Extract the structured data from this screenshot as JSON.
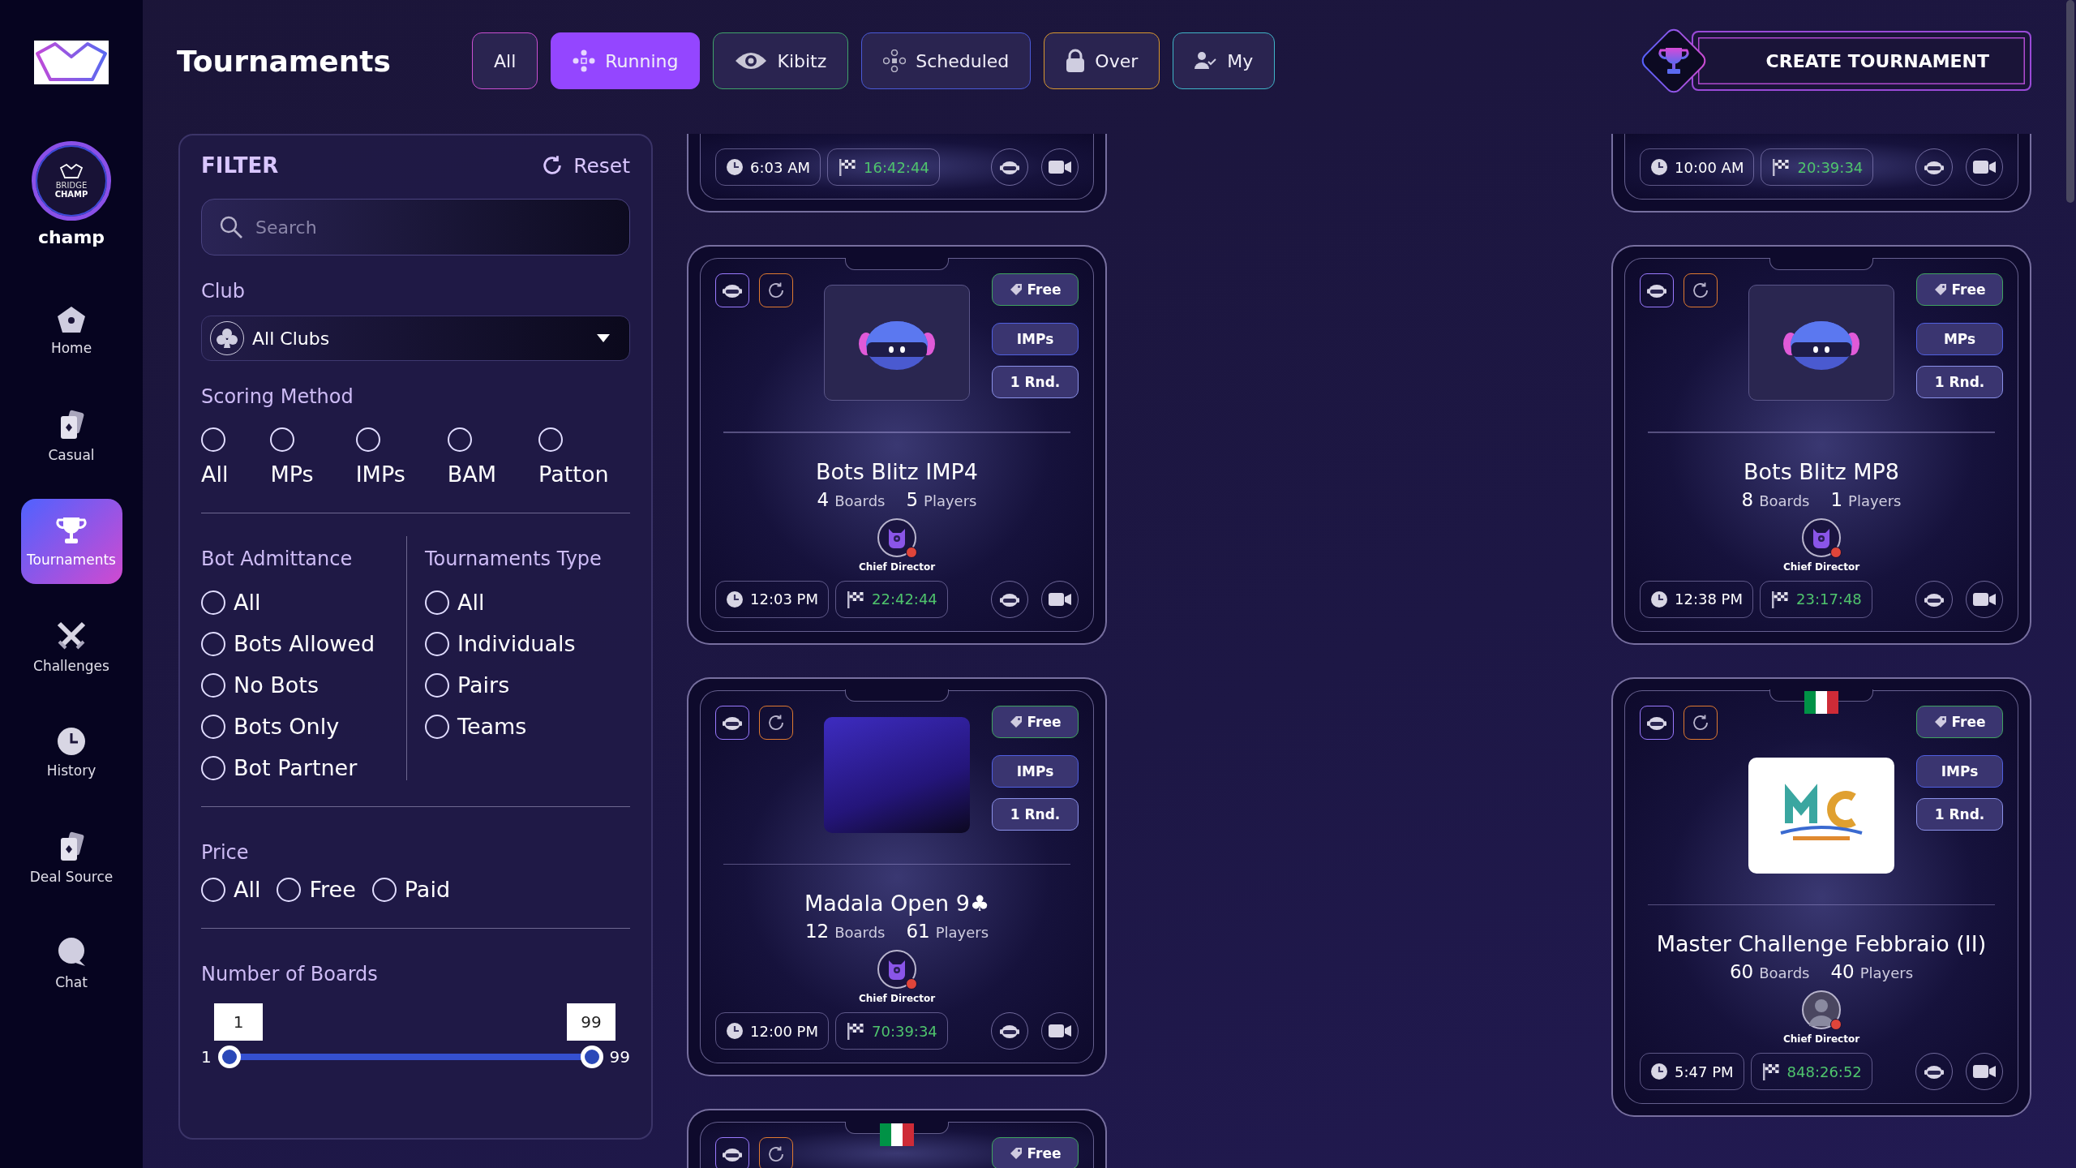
{
  "profile": {
    "avatar_lines": [
      "BRIDGE",
      "CHAMP"
    ],
    "username": "champ"
  },
  "nav": [
    {
      "label": "Home",
      "selected": false
    },
    {
      "label": "Casual",
      "selected": false
    },
    {
      "label": "Tournaments",
      "selected": true
    },
    {
      "label": "Challenges",
      "selected": false
    },
    {
      "label": "History",
      "selected": false
    },
    {
      "label": "Deal Source",
      "selected": false
    },
    {
      "label": "Chat",
      "selected": false
    }
  ],
  "header": {
    "title": "Tournaments",
    "create_button": "CREATE TOURNAMENT",
    "tabs": [
      {
        "label": "All",
        "selected": false,
        "color": "#c94fd1"
      },
      {
        "label": "Running",
        "selected": true,
        "color": "#9446ff"
      },
      {
        "label": "Kibitz",
        "selected": false,
        "color": "#3fa36a"
      },
      {
        "label": "Scheduled",
        "selected": false,
        "color": "#4a5ad8"
      },
      {
        "label": "Over",
        "selected": false,
        "color": "#d9982f"
      },
      {
        "label": "My",
        "selected": false,
        "color": "#3fb5c8"
      }
    ]
  },
  "filter": {
    "title": "FILTER",
    "reset": "Reset",
    "search": {
      "placeholder": "Search"
    },
    "club": {
      "label": "Club",
      "value": "All Clubs"
    },
    "scoring": {
      "label": "Scoring Method",
      "options": [
        {
          "label": "All",
          "selected": false
        },
        {
          "label": "MPs",
          "selected": false
        },
        {
          "label": "IMPs",
          "selected": false
        },
        {
          "label": "BAM",
          "selected": false
        },
        {
          "label": "Patton",
          "selected": false
        }
      ]
    },
    "bot_admittance": {
      "label": "Bot Admittance",
      "options": [
        {
          "label": "All",
          "selected": false
        },
        {
          "label": "Bots Allowed",
          "selected": false
        },
        {
          "label": "No Bots",
          "selected": false
        },
        {
          "label": "Bots Only",
          "selected": false
        },
        {
          "label": "Bot Partner",
          "selected": false
        }
      ]
    },
    "tournament_type": {
      "label": "Tournaments Type",
      "options": [
        {
          "label": "All",
          "selected": false
        },
        {
          "label": "Individuals",
          "selected": false
        },
        {
          "label": "Pairs",
          "selected": false
        },
        {
          "label": "Teams",
          "selected": false
        }
      ]
    },
    "price": {
      "label": "Price",
      "options": [
        {
          "label": "All",
          "selected": false
        },
        {
          "label": "Free",
          "selected": false
        },
        {
          "label": "Paid",
          "selected": false
        }
      ]
    },
    "boards": {
      "label": "Number of Boards",
      "min_label": "1",
      "max_label": "99",
      "thumbs": [
        {
          "value": "1",
          "level": 0
        },
        {
          "value": "99",
          "level": 1
        }
      ]
    }
  },
  "card_columns": [
    [
      {
        "kind": "footer",
        "start_time": "6:03 AM",
        "countdown": "16:42:44"
      },
      {
        "kind": "full",
        "image": {
          "kind": "bot"
        },
        "tags": [
          {
            "kind": "price",
            "label": "Free"
          },
          {
            "kind": "scoring",
            "label": "IMPs"
          },
          {
            "kind": "rounds",
            "label": "1 Rnd."
          }
        ],
        "title": "Bots Blitz IMP4",
        "stats": [
          {
            "number": "4",
            "unit": "Boards"
          },
          {
            "number": "5",
            "unit": "Players"
          }
        ],
        "director": {
          "kind": "bot",
          "role": "Chief Director"
        },
        "start_time": "12:03 PM",
        "countdown": "22:42:44"
      },
      {
        "kind": "full",
        "image": {
          "kind": "photo"
        },
        "tags": [
          {
            "kind": "price",
            "label": "Free"
          },
          {
            "kind": "scoring",
            "label": "IMPs"
          },
          {
            "kind": "rounds",
            "label": "1 Rnd."
          }
        ],
        "title": "Madala Open 9♣",
        "stats": [
          {
            "number": "12",
            "unit": "Boards"
          },
          {
            "number": "61",
            "unit": "Players"
          }
        ],
        "director": {
          "kind": "bot",
          "role": "Chief Director"
        },
        "start_time": "12:00 PM",
        "countdown": "70:39:34"
      },
      {
        "kind": "top",
        "flag": {
          "kind": "italy"
        },
        "tags": [
          {
            "kind": "price",
            "label": "Free"
          }
        ]
      }
    ],
    [
      {
        "kind": "footer",
        "start_time": "10:00 AM",
        "countdown": "20:39:34"
      },
      {
        "kind": "full",
        "image": {
          "kind": "bot"
        },
        "tags": [
          {
            "kind": "price",
            "label": "Free"
          },
          {
            "kind": "scoring",
            "label": "MPs"
          },
          {
            "kind": "rounds",
            "label": "1 Rnd."
          }
        ],
        "title": "Bots Blitz MP8",
        "stats": [
          {
            "number": "8",
            "unit": "Boards"
          },
          {
            "number": "1",
            "unit": "Players"
          }
        ],
        "director": {
          "kind": "bot",
          "role": "Chief Director"
        },
        "start_time": "12:38 PM",
        "countdown": "23:17:48"
      },
      {
        "kind": "full",
        "image": {
          "kind": "logo"
        },
        "flag": {
          "kind": "italy"
        },
        "tags": [
          {
            "kind": "price",
            "label": "Free"
          },
          {
            "kind": "scoring",
            "label": "IMPs"
          },
          {
            "kind": "rounds",
            "label": "1 Rnd."
          }
        ],
        "title": "Master Challenge Febbraio (II)",
        "stats": [
          {
            "number": "60",
            "unit": "Boards"
          },
          {
            "number": "40",
            "unit": "Players"
          }
        ],
        "director": {
          "kind": "photo",
          "role": "Chief Director"
        },
        "start_time": "5:47 PM",
        "countdown": "848:26:52"
      }
    ]
  ]
}
